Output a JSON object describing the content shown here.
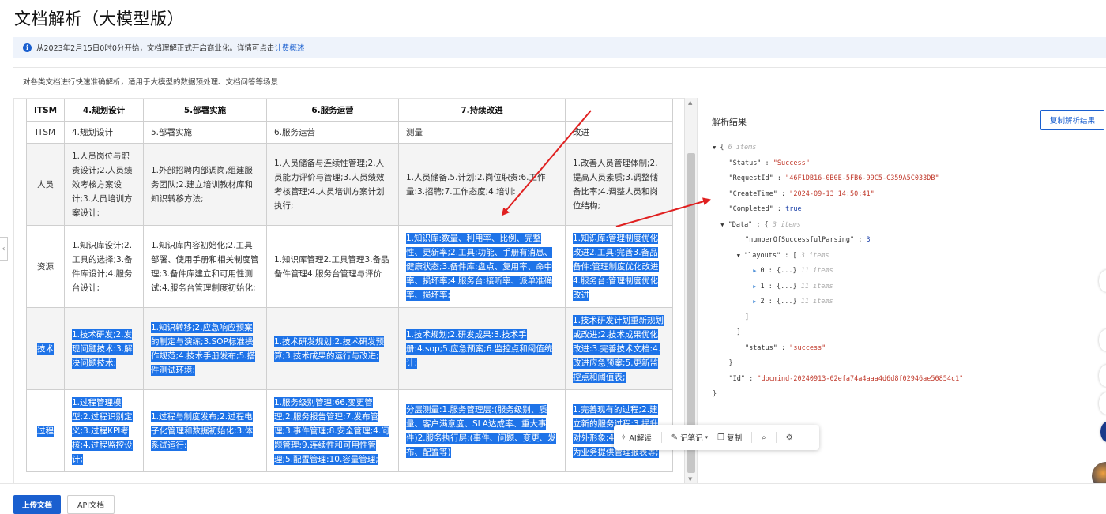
{
  "page": {
    "title": "文档解析（大模型版）"
  },
  "notice": {
    "text": "从2023年2月15日0时0分开始，文档理解正式开启商业化。详情可点击",
    "link": "计费概述"
  },
  "description": "对各类文档进行快速准确解析，适用于大模型的数据预处理、文档问答等场景",
  "table": {
    "header": [
      "ITSM",
      "4.规划设计",
      "5.部署实施",
      "6.服务运营",
      "7.持续改进",
      ""
    ],
    "row2": [
      "ITSM",
      "4.规划设计",
      "5.部署实施",
      "6.服务运营",
      "测量",
      "改进"
    ],
    "rows": [
      {
        "head": "人员",
        "cells": [
          "1.人员岗位与职责设计;2.人员绩效考核方案设计;3.人员培训方案设计:",
          "1.外部招聘内部调岗,组建服务团队;2.建立培训教材库和知识转移方法;",
          "1.人员储备与连续性管理;2.人员能力评价与管理;3.人员绩效考核管理;4.人员培训方案计划执行;",
          "1.人员储备.5.计划:2.岗位职责:6.工作量:3.招聘;7.工作态度;4.培训:",
          "1.改善人员管理体制;2.提高人员素质;3.调整储备比率;4.调整人员和岗位结构;"
        ]
      },
      {
        "head": "资源",
        "cells": [
          "1.知识库设计;2.工具的选择;3.备件库设计;4.服务台设计;",
          "1.知识库内容初始化;2.工具部署、使用手册和相关制度管理;3.备件库建立和可用性测试;4.服务台管理制度初始化;",
          "1.知识库管理2.工具管理3.备品备件管理4.服务台管理与评价",
          "1.知识库:数量、利用率、比例、完整性、更新率;2.工具:功能、手册有消息、健康状态;3.备件库:盘点、复用率、命中率、损坏率;4.服务台:接听率、派单准确率、损坏率;",
          "1.知识库:管理制度优化改进2.工具:完善3.备品备件:管理制度优化改进4.服务台:管理制度优化改进"
        ]
      },
      {
        "head": "技术",
        "cells": [
          "1.技术研发;2.发现问题技术:3.解决问题技术:",
          "1.知识转移;2.应急响应预案的制定与演练;3.SOP标准操作规范;4.技术手册发布;5.搭件测试环境;",
          "1.技术研发规划;2.技术研发预算;3.技术成果的运行与改进;",
          "1.技术规划;2.研发成果:3.技术手册:4.sop;5.应急预案;6.监控点和阈值统计:",
          "1.技术研发计划重新规划或改进;2.技术成果优化改进:3.完善技术文档:4.改进应急预案;5.更新监控点和阈值表;"
        ]
      },
      {
        "head": "过程",
        "cells": [
          "1.过程管理模型;2.过程识别定义;3.过程KPI考核;4.过程监控设计;",
          "1.过程与制度发布;2.过程电子化管理和数据初始化;3.体系试运行:",
          "1.服务级别管理;66.变更管理;2.服务报告管理:7.发布管理;3.事件管理;8.安全管理;4.问题管理:9.连续性和可用性管理;5.配置管理:10.容量管理;",
          "分层测量:1.服务管理层:(服务级别、质量、客户满意度、SLA达成率、重大事件)2.服务执行层:(事件、问题、变更、发布、配置等)",
          "1.完善现有的过程;2.建立新的服务过程;3.提升对外形象;4.完善服务;5.为业务提供管理报表等;"
        ]
      }
    ]
  },
  "result": {
    "title": "解析结果",
    "copy_label": "复制解析结果",
    "items_6": "6 items",
    "status_key": "\"Status\"",
    "status_val": "\"Success\"",
    "request_key": "\"RequestId\"",
    "request_val": "\"46F1DB16-0B0E-5FB6-99C5-C359A5C033DB\"",
    "create_key": "\"CreateTime\"",
    "create_val": "\"2024-09-13 14:50:41\"",
    "completed_key": "\"Completed\"",
    "completed_val": "true",
    "data_key": "\"Data\"",
    "items_3": "3 items",
    "nsp_key": "\"numberOfSuccessfulParsing\"",
    "nsp_val": "3",
    "layouts_key": "\"layouts\"",
    "layout_items": [
      "0",
      "1",
      "2"
    ],
    "items_11": "11 items",
    "status2_key": "\"status\"",
    "status2_val": "\"success\"",
    "id_key": "\"Id\"",
    "id_val": "\"docmind-20240913-02efa74a4aaa4d6d8f02946ae50854c1\""
  },
  "toolbar": {
    "ai": "AI解读",
    "note": "记笔记",
    "copy": "复制"
  },
  "footer": {
    "upload": "上传文档",
    "api": "API文档"
  },
  "colors": {
    "accent": "#1a5fcf",
    "selection": "#1e73e8",
    "arrow": "#e02020"
  }
}
